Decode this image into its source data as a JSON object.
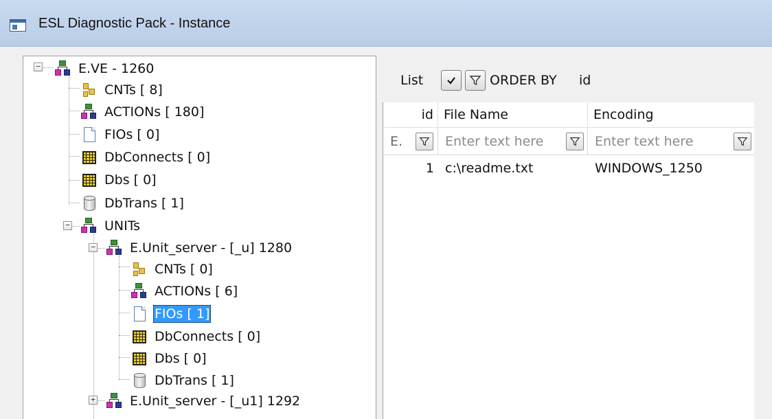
{
  "window": {
    "title": "ESL Diagnostic Pack - Instance"
  },
  "tree": {
    "nodes": [
      {
        "label": "E.VE -  1260",
        "icon": "unit-icon",
        "expander": "−"
      },
      {
        "label": "CNTs [ 8]",
        "icon": "cnt-icon"
      },
      {
        "label": "ACTIONs [ 180]",
        "icon": "unit-icon"
      },
      {
        "label": "FIOs [ 0]",
        "icon": "file-icon"
      },
      {
        "label": "DbConnects [ 0]",
        "icon": "grid-icon"
      },
      {
        "label": "Dbs [ 0]",
        "icon": "grid-icon"
      },
      {
        "label": "DbTrans [ 1]",
        "icon": "cylinder-icon"
      },
      {
        "label": "UNITs",
        "icon": "unit-icon",
        "expander": "−"
      },
      {
        "label": "E.Unit_server - [_u] 1280",
        "icon": "unit-icon",
        "expander": "−"
      },
      {
        "label": "CNTs [ 0]",
        "icon": "cnt-icon"
      },
      {
        "label": "ACTIONs [ 6]",
        "icon": "unit-icon"
      },
      {
        "label": "FIOs [ 1]",
        "icon": "file-icon",
        "selected": true
      },
      {
        "label": "DbConnects [ 0]",
        "icon": "grid-icon"
      },
      {
        "label": "Dbs [ 0]",
        "icon": "grid-icon"
      },
      {
        "label": "DbTrans [ 1]",
        "icon": "cylinder-icon"
      },
      {
        "label": "E.Unit_server - [_u1] 1292",
        "icon": "unit-icon",
        "expander": "+"
      }
    ]
  },
  "toolbar": {
    "list_label": "List",
    "order_by_label": "ORDER BY",
    "order_by_value": "id"
  },
  "grid": {
    "columns": [
      "id",
      "File Name",
      "Encoding"
    ],
    "filter": {
      "id_value": "E.",
      "placeholder": "Enter text here"
    },
    "rows": [
      {
        "id": "1",
        "file_name": "c:\\readme.txt",
        "encoding": "WINDOWS_1250"
      }
    ]
  },
  "colors": {
    "titlebar": "#c9daf0",
    "selection": "#3399ff"
  }
}
